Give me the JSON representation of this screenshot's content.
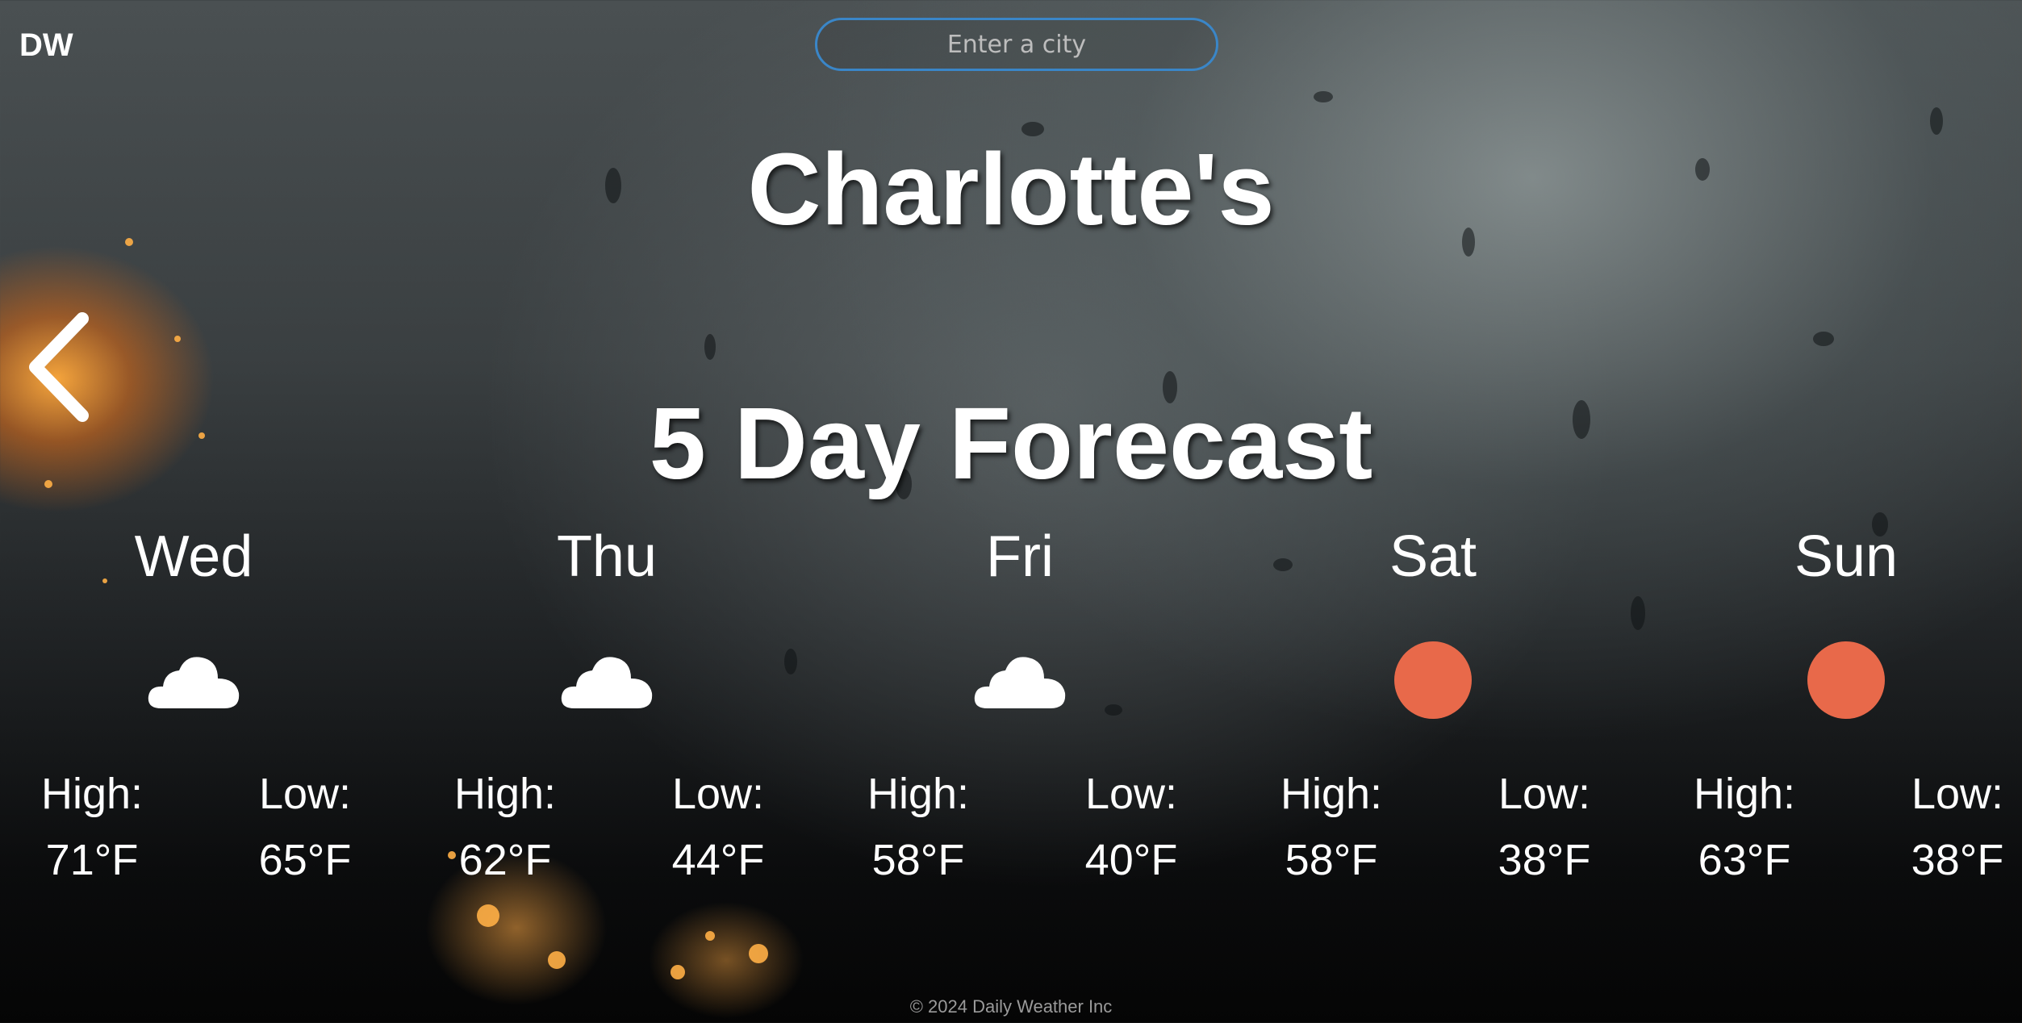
{
  "brand": "DW",
  "search": {
    "placeholder": "Enter a city"
  },
  "title": {
    "city": "Charlotte's",
    "subtitle": "5 Day Forecast"
  },
  "labels": {
    "high": "High:",
    "low": "Low:"
  },
  "colors": {
    "sun": "#e8694a",
    "cloud": "#ffffff",
    "search_border": "#3a86c8"
  },
  "forecast": [
    {
      "day": "Wed",
      "icon": "cloud-icon",
      "high": "71°F",
      "low": "65°F"
    },
    {
      "day": "Thu",
      "icon": "cloud-icon",
      "high": "62°F",
      "low": "44°F"
    },
    {
      "day": "Fri",
      "icon": "cloud-icon",
      "high": "58°F",
      "low": "40°F"
    },
    {
      "day": "Sat",
      "icon": "sun-icon",
      "high": "58°F",
      "low": "38°F"
    },
    {
      "day": "Sun",
      "icon": "sun-icon",
      "high": "63°F",
      "low": "38°F"
    }
  ],
  "footer": "© 2024 Daily Weather Inc"
}
